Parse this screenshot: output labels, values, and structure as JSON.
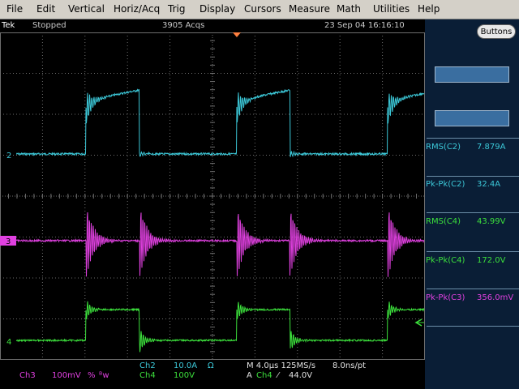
{
  "menu": {
    "items": [
      "File",
      "Edit",
      "Vertical",
      "Horiz/Acq",
      "Trig",
      "Display",
      "Cursors",
      "Measure",
      "Math",
      "Utilities",
      "Help"
    ]
  },
  "status": {
    "brand": "Tek",
    "state": "Stopped",
    "acqs": "3905 Acqs",
    "datetime": "23 Sep 04 16:16:10"
  },
  "buttons_label": "Buttons",
  "channel_markers": {
    "ch2": "2",
    "ch3": "3",
    "ch4": "4"
  },
  "measurements": [
    {
      "label": "RMS(C2)",
      "value": "7.879A",
      "color": "#3cc8d8"
    },
    {
      "label": "Pk-Pk(C2)",
      "value": "32.4A",
      "color": "#3cc8d8"
    },
    {
      "label": "RMS(C4)",
      "value": "43.99V",
      "color": "#3ce03c"
    },
    {
      "label": "Pk-Pk(C4)",
      "value": "172.0V",
      "color": "#3ce03c"
    },
    {
      "label": "Pk-Pk(C3)",
      "value": "356.0mV",
      "color": "#e040e0"
    }
  ],
  "bottom": {
    "ch3_name": "Ch3",
    "ch3_scale": "100mV",
    "ch3_sym1": "%",
    "ch3_sym2": "ᴮw",
    "ch2_name": "Ch2",
    "ch2_scale": "10.0A",
    "ch2_unit": "Ω",
    "ch4_name": "Ch4",
    "ch4_scale": "100V",
    "timebase": "M 4.0µs 125MS/s",
    "resolution": "8.0ns/pt",
    "trig_mode": "A",
    "trig_source": "Ch4",
    "trig_slope": "⁄",
    "trig_level": "44.0V"
  },
  "colors": {
    "ch2": "#3cc8d8",
    "ch3": "#e040e0",
    "ch4": "#3ce03c",
    "trigger": "#ff8040",
    "grid": "#6e6e6e"
  }
}
